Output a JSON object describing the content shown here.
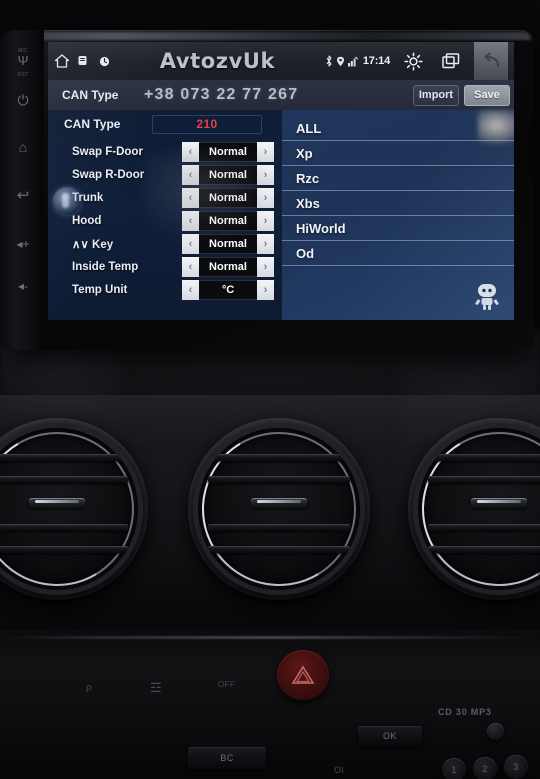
{
  "device": {
    "brand_logo": "AvtozvUk",
    "side_buttons": [
      {
        "name": "mic",
        "label": "MIC",
        "glyph": "Ψ"
      },
      {
        "name": "reset",
        "label": "RST",
        "glyph": ""
      },
      {
        "name": "power",
        "label": "",
        "glyph": "⏻"
      },
      {
        "name": "home",
        "label": "",
        "glyph": "⌂"
      },
      {
        "name": "back",
        "label": "",
        "glyph": "↩"
      },
      {
        "name": "volume-up",
        "label": "",
        "glyph": "◂+"
      },
      {
        "name": "volume-down",
        "label": "",
        "glyph": "◂-"
      }
    ]
  },
  "statusbar": {
    "home_icon": "home-icon",
    "apps_icon": "apps-icon",
    "clock_icon": "clock-icon",
    "logo": "AvtozvUk",
    "bluetooth_icon": "bluetooth-icon",
    "gps_icon": "gps-icon",
    "signal_icon": "signal-icon",
    "time": "17:14",
    "brightness_icon": "brightness-icon",
    "recents_icon": "recents-icon",
    "back_icon": "back-icon"
  },
  "header": {
    "label": "CAN Type",
    "phone": "+38 073 22 77 267",
    "import_label": "Import",
    "save_label": "Save"
  },
  "can_type": {
    "label": "CAN Type",
    "value": "210",
    "value_color": "#e0414b"
  },
  "settings": {
    "rows": [
      {
        "label": "Swap F-Door",
        "value": "Normal"
      },
      {
        "label": "Swap R-Door",
        "value": "Normal"
      },
      {
        "label": "Trunk",
        "value": "Normal"
      },
      {
        "label": "Hood",
        "value": "Normal"
      },
      {
        "label": "∧∨ Key",
        "value": "Normal"
      },
      {
        "label": "Inside Temp",
        "value": "Normal"
      },
      {
        "label": "Temp Unit",
        "value": "°C"
      }
    ],
    "prev_arrow": "‹",
    "next_arrow": "›"
  },
  "protocol_list": {
    "items": [
      "ALL",
      "Xp",
      "Rzc",
      "Xbs",
      "HiWorld",
      "Od"
    ],
    "mascot_icon": "android-robot-icon"
  },
  "car_console": {
    "hazard_icon": "hazard-triangle-icon",
    "parking_sensor_label": "P",
    "defrost_rear_label": "☲",
    "traction_off_label": "OFF",
    "cd_label": "CD 30 MP3",
    "bc_button": "BC",
    "ok_button": "OK",
    "ol_label": "Ol",
    "preset_buttons": [
      "1",
      "2",
      "3"
    ]
  }
}
